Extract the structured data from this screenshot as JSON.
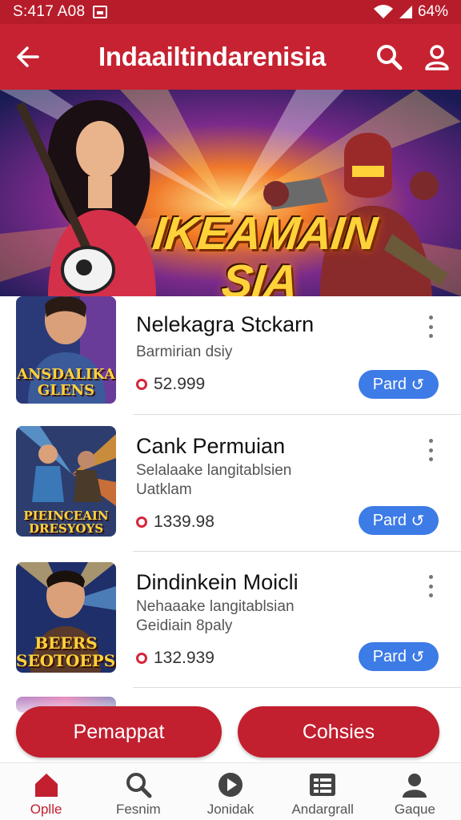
{
  "status_bar": {
    "time": "S:417 A08",
    "battery": "64%",
    "icons": [
      "image-icon",
      "wifi-icon",
      "signal-icon"
    ]
  },
  "app_bar": {
    "title": "Indaailtindarenisia",
    "back_icon": "arrow-left-icon",
    "actions": [
      "search-icon",
      "profile-icon"
    ]
  },
  "banner": {
    "title_line1": "IKEAMAIN",
    "title_line2": "SIA"
  },
  "items": [
    {
      "title": "Nelekagra Stckarn",
      "desc": "Barmirian dsiy",
      "price": "52.999",
      "button": "Pard",
      "thumb_text": "ANSDALIKA GLENS"
    },
    {
      "title": "Cank Permuian",
      "desc": "Selalaake langitablsien Uatklam",
      "price": "1339.98",
      "button": "Pard",
      "thumb_text": "PIEINCEAIN DRESYOYS"
    },
    {
      "title": "Dindinkein Moicli",
      "desc": "Nehaaake langitablsian Geidiain 8paly",
      "price": "132.939",
      "button": "Pard",
      "thumb_text": "BEERS SEOTOEPSIA"
    }
  ],
  "actions": {
    "primary": "Pemappat",
    "secondary": "Cohsies"
  },
  "bottom_nav": [
    {
      "label": "Oplle",
      "icon": "home-icon",
      "active": true
    },
    {
      "label": "Fesnim",
      "icon": "search-icon",
      "active": false
    },
    {
      "label": "Jonidak",
      "icon": "play-icon",
      "active": false
    },
    {
      "label": "Andargrall",
      "icon": "list-icon",
      "active": false
    },
    {
      "label": "Gaque",
      "icon": "profile-icon",
      "active": false
    }
  ],
  "colors": {
    "brand_red": "#c62232",
    "button_blue": "#3d7be6"
  }
}
